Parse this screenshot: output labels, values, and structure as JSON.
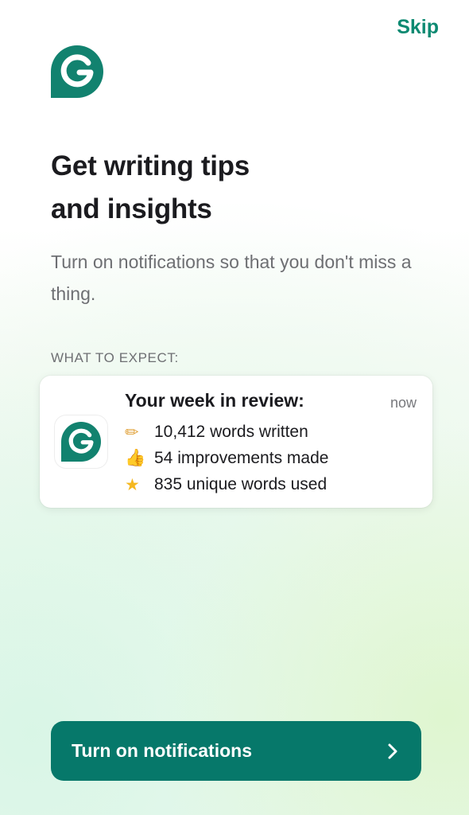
{
  "header": {
    "skip_label": "Skip"
  },
  "brand": {
    "logo_icon": "grammarly-logo-icon",
    "accent_color": "#0e8a72",
    "button_color": "#06786a"
  },
  "onboarding": {
    "title_line1": "Get writing tips",
    "title_line2": "and insights",
    "subtitle": "Turn on notifications so that you don't miss a thing.",
    "expect_label": "WHAT TO EXPECT:"
  },
  "notification": {
    "app_icon": "grammarly-logo-icon",
    "title": "Your week in review:",
    "time": "now",
    "lines": [
      {
        "icon": "pencil-icon",
        "glyph": "✏",
        "text": "10,412 words written"
      },
      {
        "icon": "thumbs-up-icon",
        "glyph": "👍",
        "text": "54 improvements made"
      },
      {
        "icon": "star-icon",
        "glyph": "★",
        "text": "835 unique words used"
      }
    ]
  },
  "cta": {
    "label": "Turn on notifications",
    "icon": "chevron-right-icon"
  }
}
